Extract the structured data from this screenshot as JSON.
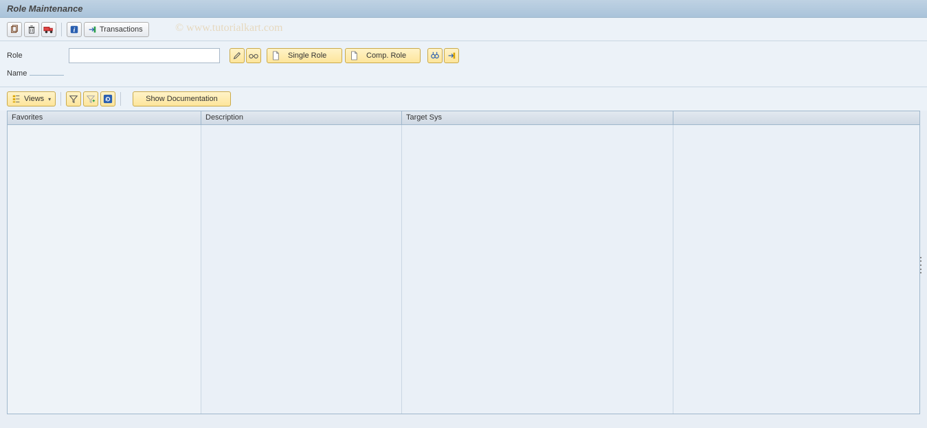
{
  "title": "Role Maintenance",
  "watermark": "© www.tutorialkart.com",
  "toolbar": {
    "transactions_label": "Transactions"
  },
  "form": {
    "role_label": "Role",
    "role_value": "",
    "name_label": "Name",
    "name_value": "",
    "single_role_label": "Single Role",
    "comp_role_label": "Comp. Role"
  },
  "views_bar": {
    "views_label": "Views",
    "show_doc_label": "Show Documentation"
  },
  "grid": {
    "columns": {
      "favorites": "Favorites",
      "description": "Description",
      "target_sys": "Target Sys"
    },
    "rows": []
  },
  "icons": {
    "copy": "copy-icon",
    "delete": "delete-icon",
    "transport": "transport-icon",
    "info": "info-icon",
    "transactions": "transactions-icon",
    "edit": "pencil-icon",
    "display": "glasses-icon",
    "create1": "document-icon",
    "create2": "document-icon",
    "find": "binoculars-icon",
    "export": "export-icon",
    "views": "hierarchy-icon",
    "filter": "filter-icon",
    "filter2": "filter-plus-icon",
    "refresh": "refresh-icon"
  }
}
